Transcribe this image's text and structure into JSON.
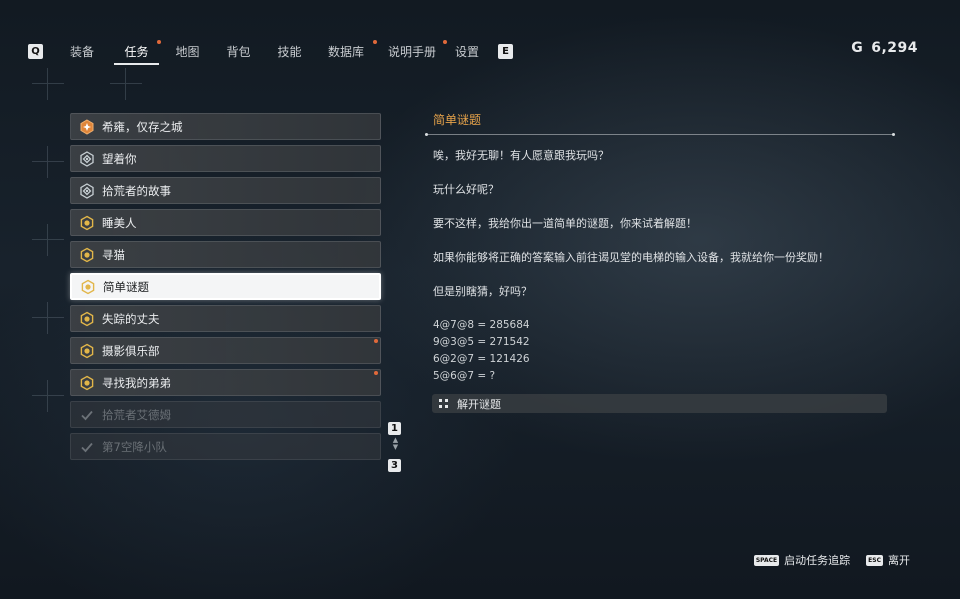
{
  "nav": {
    "left_key": "Q",
    "right_key": "E",
    "tabs": [
      {
        "label": "装备",
        "active": false,
        "dot": false
      },
      {
        "label": "任务",
        "active": true,
        "dot": true
      },
      {
        "label": "地图",
        "active": false,
        "dot": false
      },
      {
        "label": "背包",
        "active": false,
        "dot": false
      },
      {
        "label": "技能",
        "active": false,
        "dot": false
      },
      {
        "label": "数据库",
        "active": false,
        "dot": true
      },
      {
        "label": "说明手册",
        "active": false,
        "dot": true
      },
      {
        "label": "设置",
        "active": false,
        "dot": false
      }
    ]
  },
  "currency": {
    "symbol": "G",
    "amount": "6,294"
  },
  "quests": [
    {
      "label": "希雍，仅存之城",
      "icon": "main-quest-icon",
      "state": "normal",
      "dot": false
    },
    {
      "label": "望着你",
      "icon": "side-quest-icon",
      "state": "normal",
      "dot": false
    },
    {
      "label": "拾荒者的故事",
      "icon": "side-quest-icon",
      "state": "normal",
      "dot": false
    },
    {
      "label": "睡美人",
      "icon": "request-icon",
      "state": "normal",
      "dot": false
    },
    {
      "label": "寻猫",
      "icon": "request-icon",
      "state": "normal",
      "dot": false
    },
    {
      "label": "简单谜题",
      "icon": "request-icon",
      "state": "selected",
      "dot": false
    },
    {
      "label": "失踪的丈夫",
      "icon": "request-icon",
      "state": "normal",
      "dot": false
    },
    {
      "label": "摄影俱乐部",
      "icon": "request-icon",
      "state": "normal",
      "dot": true
    },
    {
      "label": "寻找我的弟弟",
      "icon": "request-icon",
      "state": "normal",
      "dot": true
    },
    {
      "label": "拾荒者艾德姆",
      "icon": "check-icon",
      "state": "done",
      "dot": false
    },
    {
      "label": "第7空降小队",
      "icon": "check-icon",
      "state": "done",
      "dot": false
    }
  ],
  "pager": {
    "top_key": "1",
    "bottom_key": "3"
  },
  "detail": {
    "title": "简单谜题",
    "paragraphs": [
      "唉，我好无聊！有人愿意跟我玩吗？",
      "玩什么好呢？",
      "要不这样，我给你出一道简单的谜题，你来试着解题！",
      "如果你能够将正确的答案输入前往谒见堂的电梯的输入设备，我就给你一份奖励！",
      "但是别瞎猜，好吗？"
    ],
    "puzzle_lines": [
      "4@7@8 = 285684",
      "9@3@5 = 271542",
      "6@2@7 = 121426",
      "5@6@7 = ?"
    ],
    "action_label": "解开谜题"
  },
  "footer": {
    "track_key": "SPACE",
    "track_label": "启动任务追踪",
    "leave_key": "ESC",
    "leave_label": "离开"
  },
  "colors": {
    "accent_orange": "#e5a24a",
    "notify_dot": "#e0693a",
    "request_yellow": "#e2b649"
  }
}
